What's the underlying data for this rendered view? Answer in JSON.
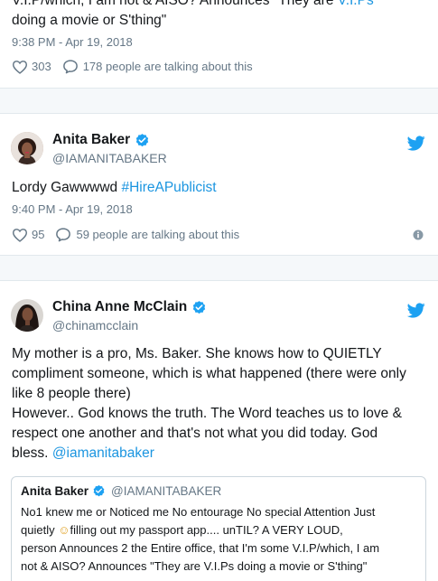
{
  "tweet1": {
    "text_line1_a": "V.I.P/which, I am not & AISO? Announces \"They are ",
    "text_line1_b": "V.I.Ps",
    "text_line2": "doing a movie or S'thing\"",
    "timestamp": "9:38 PM - Apr 19, 2018",
    "likes": "303",
    "talking": "178 people are talking about this"
  },
  "tweet2": {
    "name": "Anita Baker",
    "handle": "@IAMANITABAKER",
    "text_a": "Lordy Gawwwwd ",
    "hashtag": "#HireAPublicist",
    "timestamp": "9:40 PM - Apr 19, 2018",
    "likes": "95",
    "talking": "59 people are talking about this"
  },
  "tweet3": {
    "name": "China Anne McClain",
    "handle": "@chinamcclain",
    "lines": [
      "My mother is a pro, Ms. Baker. She knows how to QUIETLY",
      "compliment someone, which is what happened (there were only",
      "like 8 people there)",
      "However.. God knows the truth. The Word teaches us to love &",
      "respect one another and that's not what you did today. God",
      "bless. "
    ],
    "mention": "@iamanitabaker",
    "quote": {
      "name": "Anita Baker",
      "handle": "@IAMANITABAKER",
      "line1": "No1 knew me or Noticed me No entourage No special Attention Just",
      "line2_a": "quietly ",
      "emoji": "☺",
      "line2_b": "filling out my passport app.... unTIL? A VERY LOUD,",
      "line3": "person Announces 2 the Entire office, that I'm some V.I.P/which, I am",
      "line4": "not & AISO? Announces \"They are V.I.Ps doing a movie or S'thing\""
    }
  },
  "colors": {
    "link": "#1b95e0",
    "heart": "#657786",
    "verified": "#1da1f2",
    "twitter": "#1da1f2"
  },
  "icons": [
    "heart-icon",
    "comment-icon",
    "verified-badge-icon",
    "twitter-bird-icon",
    "info-icon"
  ]
}
